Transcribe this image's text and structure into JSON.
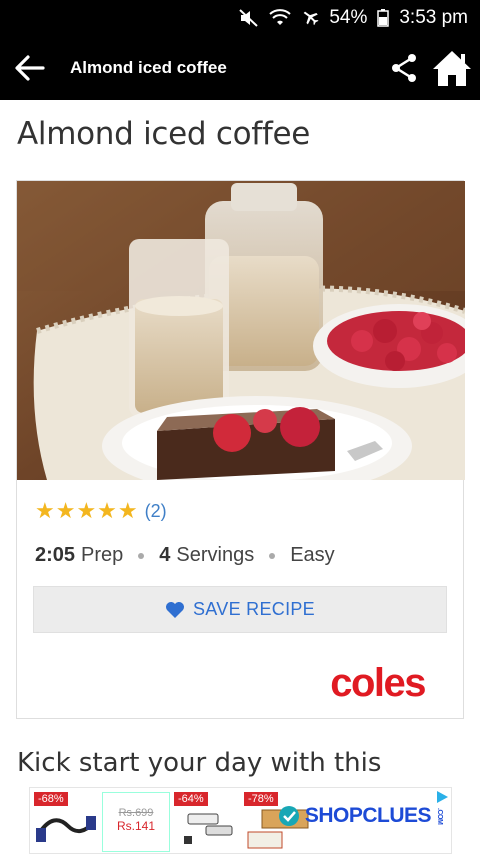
{
  "status_bar": {
    "battery_percent": "54%",
    "time": "3:53 pm",
    "icons": [
      "mute-icon",
      "wifi-icon",
      "airplane-icon",
      "battery-icon"
    ]
  },
  "app_bar": {
    "title": "Almond iced coffee",
    "icons": [
      "back-arrow-icon",
      "share-icon",
      "home-icon"
    ]
  },
  "recipe": {
    "title": "Almond iced coffee",
    "stars": "★★★★★",
    "rating_count": "(2)",
    "prep_time": "2:05",
    "prep_label": "Prep",
    "servings": "4",
    "servings_label": "Servings",
    "difficulty": "Easy",
    "save_label": "SAVE RECIPE",
    "brand": "coles",
    "intro": "Kick start your day with this"
  },
  "ad": {
    "discounts": [
      "-68%",
      "-64%",
      "-78%"
    ],
    "old_price": "Rs.699",
    "new_price": "Rs.141",
    "cta": "SHOPCLUES",
    "cta_suffix": ".COM"
  },
  "colors": {
    "accent_blue": "#2f6fd1",
    "star_yellow": "#f3b61f",
    "brand_red": "#e01a22",
    "app_bar": "#000000"
  }
}
